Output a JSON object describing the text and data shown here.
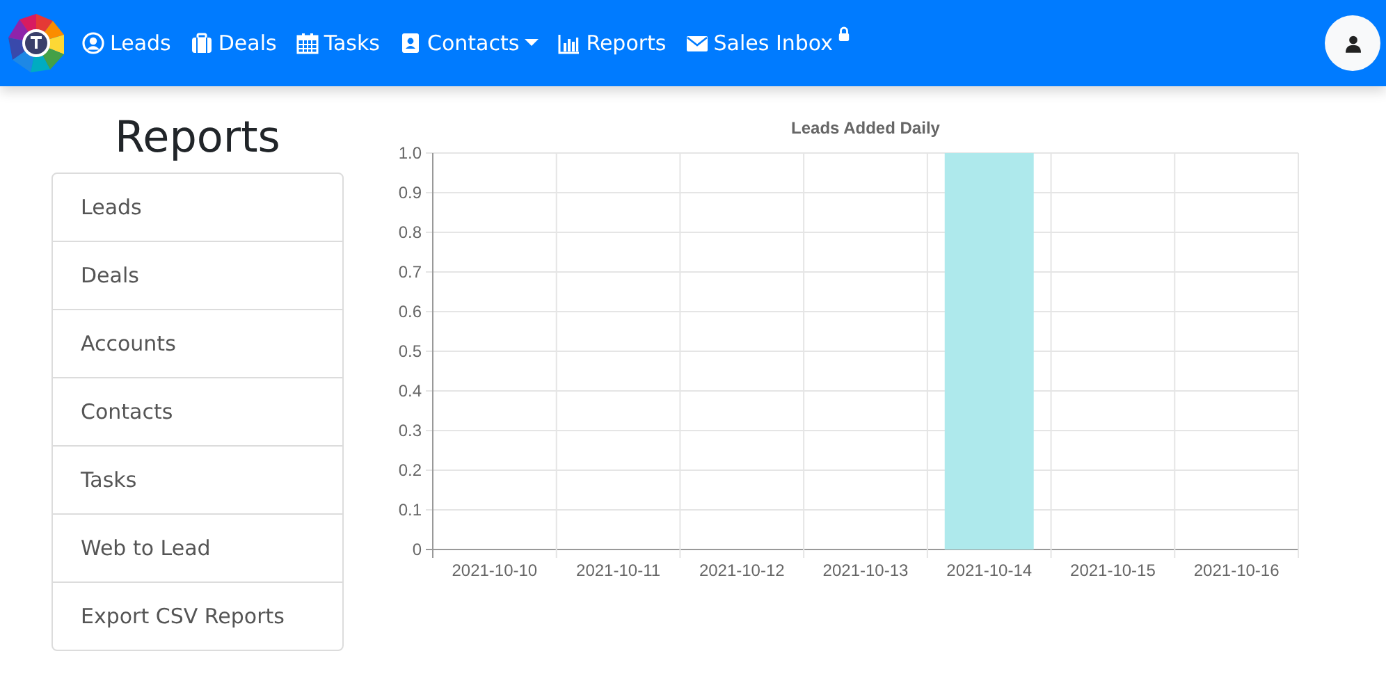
{
  "navbar": {
    "items": [
      {
        "label": "Leads",
        "dropdown": false,
        "locked": false
      },
      {
        "label": "Deals",
        "dropdown": false,
        "locked": false
      },
      {
        "label": "Tasks",
        "dropdown": false,
        "locked": false
      },
      {
        "label": "Contacts",
        "dropdown": true,
        "locked": false
      },
      {
        "label": "Reports",
        "dropdown": false,
        "locked": false
      },
      {
        "label": "Sales Inbox",
        "dropdown": false,
        "locked": true
      }
    ]
  },
  "sidebar": {
    "title": "Reports",
    "items": [
      "Leads",
      "Deals",
      "Accounts",
      "Contacts",
      "Tasks",
      "Web to Lead",
      "Export CSV Reports"
    ]
  },
  "chart": {
    "chart_data": {
      "type": "bar",
      "title": "Leads Added Daily",
      "categories": [
        "2021-10-10",
        "2021-10-11",
        "2021-10-12",
        "2021-10-13",
        "2021-10-14",
        "2021-10-15",
        "2021-10-16"
      ],
      "series": [
        {
          "color": "#aee9ec",
          "values": [
            0,
            0,
            0,
            0,
            1,
            0,
            0
          ]
        }
      ],
      "grid": true,
      "ylim": [
        0,
        1
      ],
      "yticks": [
        0,
        0.1,
        0.2,
        0.3,
        0.4,
        0.5,
        0.6,
        0.7,
        0.8,
        0.9,
        {
          "value": 1,
          "label": "1.0"
        }
      ]
    }
  }
}
